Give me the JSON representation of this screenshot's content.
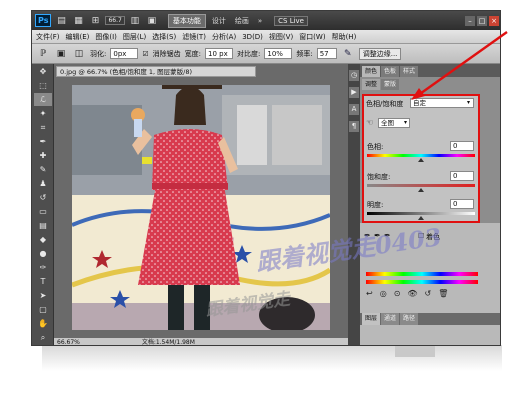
{
  "appbar": {
    "logo": "Ps",
    "zoom": "66.7",
    "workspace_active": "基本功能",
    "workspace_items": [
      "设计",
      "绘画"
    ],
    "more": "»",
    "cslive": "CS Live"
  },
  "menu": [
    "文件(F)",
    "编辑(E)",
    "图像(I)",
    "图层(L)",
    "选择(S)",
    "滤镜(T)",
    "分析(A)",
    "3D(D)",
    "视图(V)",
    "窗口(W)",
    "帮助(H)"
  ],
  "options": {
    "feather_label": "羽化:",
    "feather_value": "0px",
    "antialias_label": "消除锯齿",
    "width_label": "宽度:",
    "width_value": "10 px",
    "contrast_label": "对比度:",
    "contrast_value": "10%",
    "frequency_label": "频率:",
    "frequency_value": "57",
    "refine_button": "调整边缘..."
  },
  "document": {
    "tab_title": "0.jpg @ 66.7% (色相/饱和度 1, 图层蒙版/8)",
    "zoom": "66.67%",
    "doc_info": "文档:1.54M/1.98M"
  },
  "panel": {
    "tabs": [
      "颜色",
      "色板",
      "样式"
    ],
    "sub_tabs": [
      "调整",
      "蒙版"
    ],
    "title": "色相/饱和度",
    "preset": "自定",
    "channel": "全图",
    "hue_label": "色相:",
    "hue_value": "0",
    "sat_label": "饱和度:",
    "sat_value": "0",
    "light_label": "明度:",
    "light_value": "0",
    "colorize_label": "着色",
    "bottom_tabs": [
      "图层",
      "通道",
      "路径"
    ]
  },
  "watermark": {
    "line1": "跟着视觉走0403",
    "line2": "跟着视觉走"
  },
  "colors": {
    "highlight": "#e01010",
    "dress": "#d83a4e",
    "accent": "#31a8ff"
  }
}
